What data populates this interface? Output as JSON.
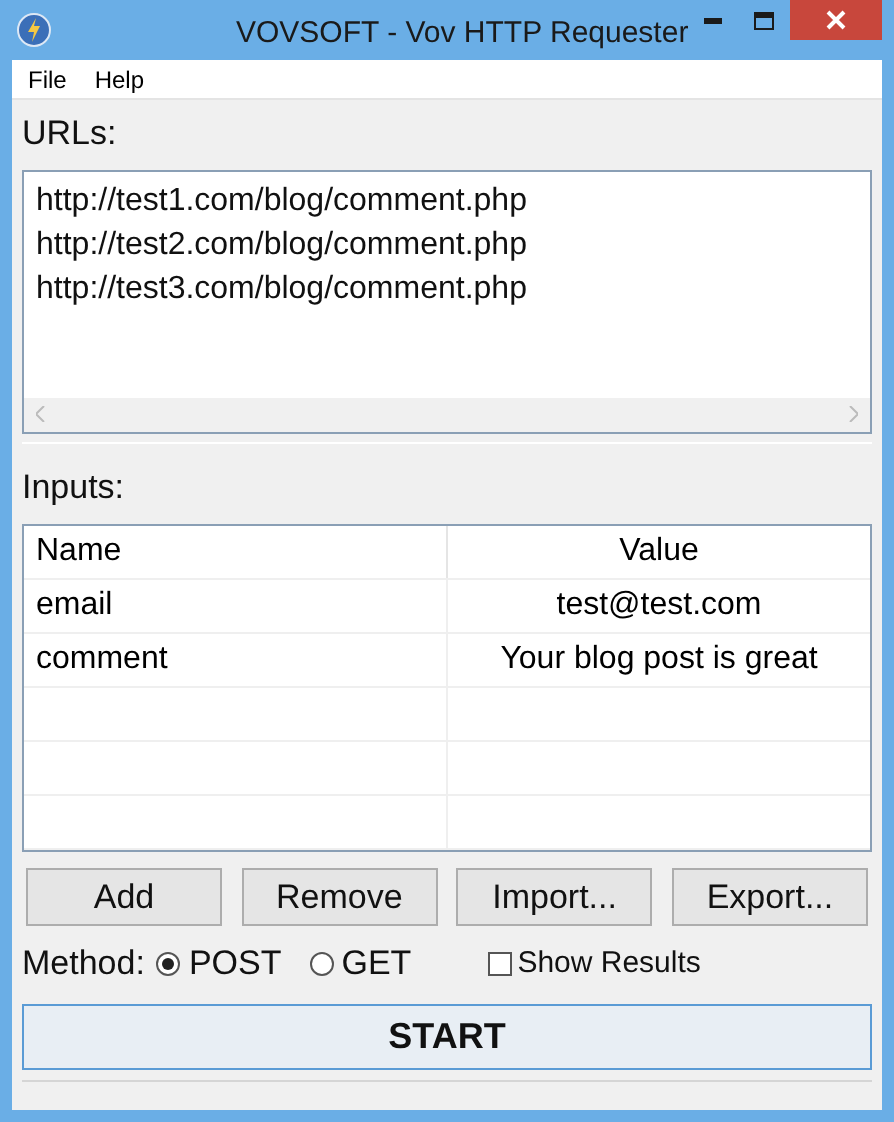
{
  "window": {
    "title": "VOVSOFT - Vov HTTP Requester"
  },
  "menu": [
    "File",
    "Help"
  ],
  "urls": {
    "label": "URLs:",
    "lines": [
      "http://test1.com/blog/comment.php",
      "http://test2.com/blog/comment.php",
      "http://test3.com/blog/comment.php"
    ]
  },
  "inputs": {
    "label": "Inputs:",
    "columns": [
      "Name",
      "Value"
    ],
    "rows": [
      [
        "email",
        "test@test.com"
      ],
      [
        "comment",
        "Your blog post is great"
      ]
    ]
  },
  "buttons": [
    "Add",
    "Remove",
    "Import...",
    "Export..."
  ],
  "method": {
    "label": "Method:",
    "options": [
      {
        "label": "POST",
        "selected": true
      },
      {
        "label": "GET",
        "selected": false
      }
    ]
  },
  "show_results": {
    "label": "Show Results",
    "checked": false
  },
  "start_button": "START"
}
